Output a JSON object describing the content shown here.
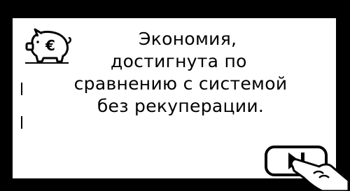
{
  "screen": {
    "message_lines": [
      "Экономия,",
      "достигнута по",
      "сравнению с системой",
      "без рекуперации."
    ]
  },
  "icons": {
    "savings": "piggy-bank-euro-icon",
    "next": "play-next-icon",
    "pointer": "hand-pointer-icon"
  },
  "colors": {
    "frame": "#000000",
    "screen": "#ffffff",
    "text": "#000000"
  }
}
